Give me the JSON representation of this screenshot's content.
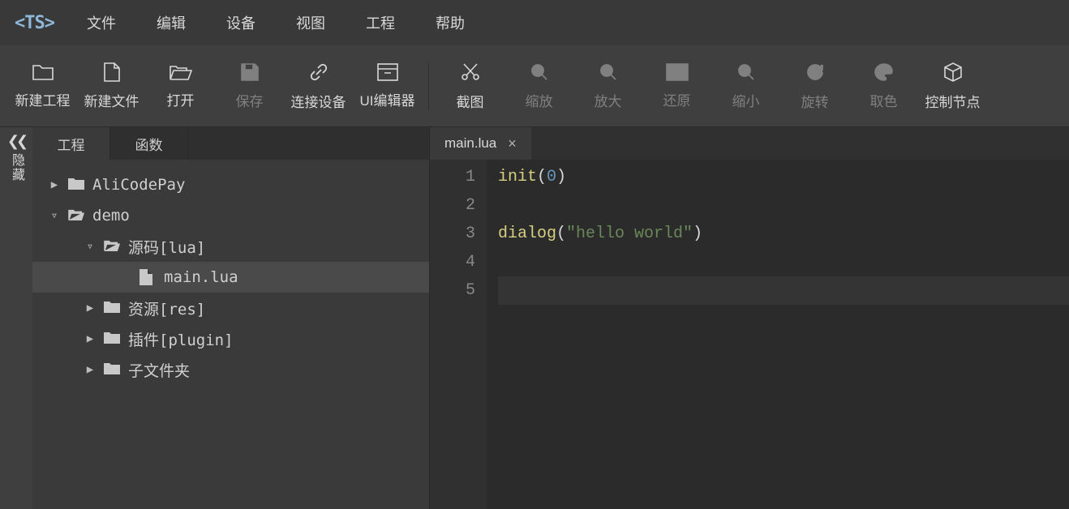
{
  "app": {
    "logo": "<TS>"
  },
  "menu": {
    "file": "文件",
    "edit": "编辑",
    "device": "设备",
    "view": "视图",
    "project": "工程",
    "help": "帮助"
  },
  "toolbar": {
    "new_project": "新建工程",
    "new_file": "新建文件",
    "open": "打开",
    "save": "保存",
    "connect_device": "连接设备",
    "ui_editor": "UI编辑器",
    "screenshot": "截图",
    "zoom": "缩放",
    "zoom_in": "放大",
    "reset_zoom": "还原",
    "zoom_out": "缩小",
    "rotate": "旋转",
    "pick_color": "取色",
    "control_node": "控制节点"
  },
  "collapse": {
    "label": "隐藏"
  },
  "side_tabs": {
    "project": "工程",
    "functions": "函数"
  },
  "tree": {
    "items": [
      {
        "name": "AliCodePay",
        "depth": 0,
        "expanded": false,
        "type": "folder"
      },
      {
        "name": "demo",
        "depth": 0,
        "expanded": true,
        "type": "folder-open"
      },
      {
        "name": "源码[lua]",
        "depth": 1,
        "expanded": true,
        "type": "folder-open"
      },
      {
        "name": "main.lua",
        "depth": 2,
        "expanded": null,
        "type": "file",
        "selected": true
      },
      {
        "name": "资源[res]",
        "depth": 1,
        "expanded": false,
        "type": "folder"
      },
      {
        "name": "插件[plugin]",
        "depth": 1,
        "expanded": false,
        "type": "folder"
      },
      {
        "name": "子文件夹",
        "depth": 1,
        "expanded": false,
        "type": "folder"
      }
    ]
  },
  "editor": {
    "tab": {
      "name": "main.lua"
    },
    "line_numbers": [
      "1",
      "2",
      "3",
      "4",
      "5"
    ],
    "code": {
      "l1": {
        "fn": "init",
        "open": "(",
        "arg": "0",
        "close": ")"
      },
      "l3": {
        "fn": "dialog",
        "open": "(",
        "arg": "\"hello world\"",
        "close": ")"
      }
    }
  }
}
